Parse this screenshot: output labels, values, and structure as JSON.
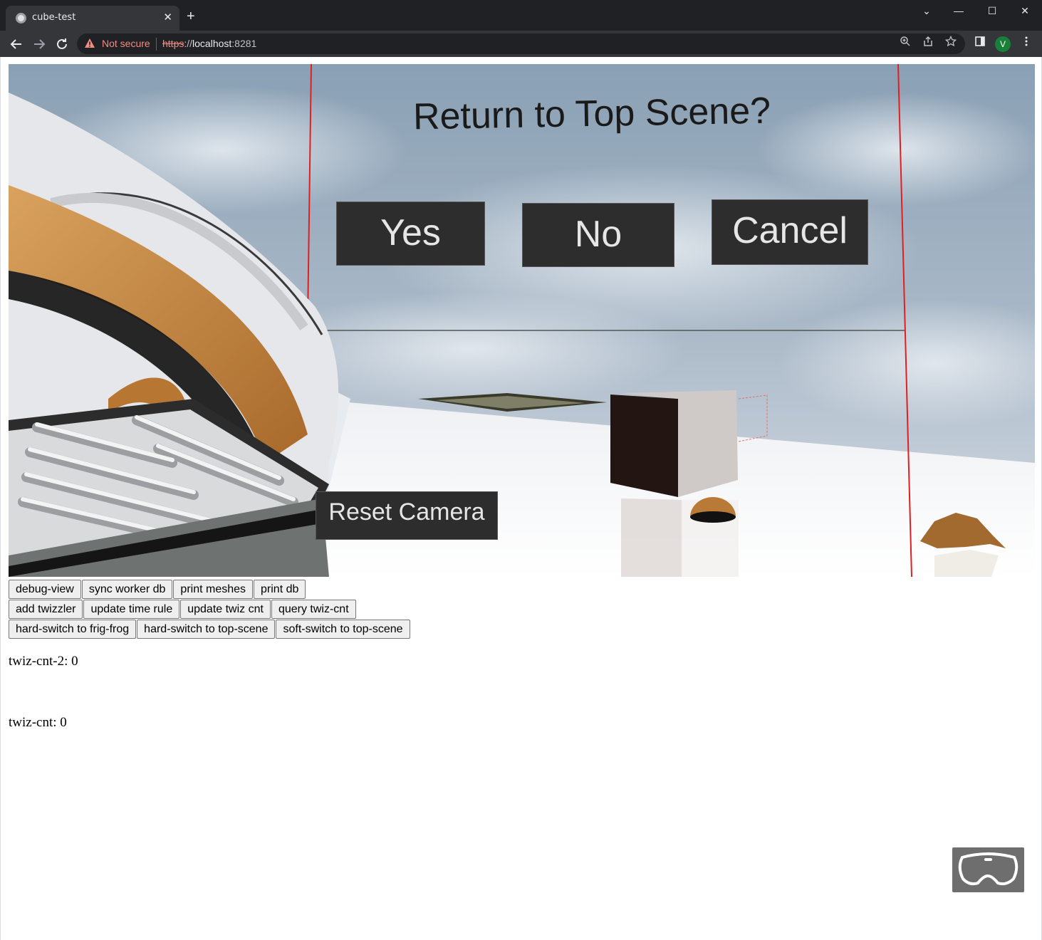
{
  "browser": {
    "tab_title": "cube-test",
    "tab_close": "✕",
    "new_tab": "+",
    "window_controls": {
      "dropdown": "⌄",
      "minimize": "—",
      "maximize": "☐",
      "close": "✕"
    },
    "security_label": "Not secure",
    "url_scheme": "https",
    "url_sep": "://",
    "url_host": "localhost",
    "url_port": ":8281",
    "profile_initial": "V"
  },
  "scene": {
    "dialog_title": "Return to Top Scene?",
    "buttons": {
      "yes": "Yes",
      "no": "No",
      "cancel": "Cancel"
    },
    "reset_camera": "Reset Camera"
  },
  "controls": {
    "row1": [
      "debug-view",
      "sync worker db",
      "print meshes",
      "print db"
    ],
    "row2": [
      "add twizzler",
      "update time rule",
      "update twiz cnt",
      "query twiz-cnt"
    ],
    "row3": [
      "hard-switch to frig-frog",
      "hard-switch to top-scene",
      "soft-switch to top-scene"
    ]
  },
  "stats": {
    "twiz_cnt_2": "twiz-cnt-2: 0",
    "twiz_cnt": "twiz-cnt: 0"
  },
  "icons": {
    "back": "back-arrow-icon",
    "forward": "forward-arrow-icon",
    "reload": "reload-icon",
    "warning": "warning-triangle-icon",
    "zoom": "zoom-icon",
    "share": "share-icon",
    "bookmark": "star-icon",
    "side_panel": "side-panel-icon",
    "menu": "kebab-menu-icon",
    "vr": "vr-headset-icon"
  },
  "colors": {
    "chrome_dark": "#202124",
    "chrome_toolbar": "#35363a",
    "insecure_red": "#f28b82",
    "panel_button": "#2d2d2d",
    "vr_button": "#6e6e6e"
  }
}
